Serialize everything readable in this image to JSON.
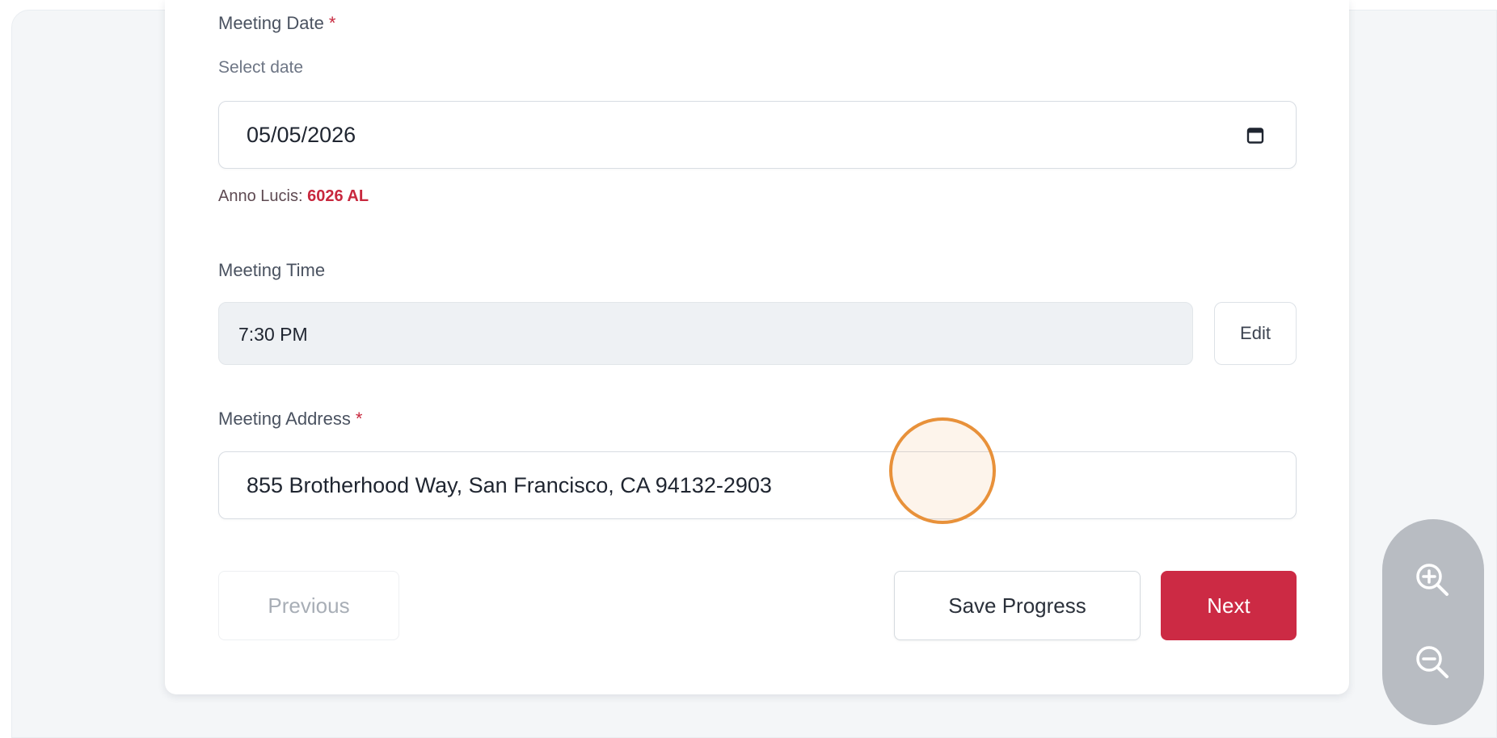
{
  "form": {
    "meeting_date": {
      "label": "Meeting Date",
      "required_mark": "*",
      "helper": "Select date",
      "value": "05/05/2026",
      "icon": "calendar-icon"
    },
    "anno_lucis": {
      "label": "Anno Lucis:",
      "value": "6026 AL"
    },
    "meeting_time": {
      "label": "Meeting Time",
      "value": "7:30 PM",
      "edit_label": "Edit"
    },
    "meeting_address": {
      "label": "Meeting Address",
      "required_mark": "*",
      "value": "855 Brotherhood Way, San Francisco, CA 94132-2903"
    }
  },
  "actions": {
    "previous_label": "Previous",
    "save_label": "Save Progress",
    "next_label": "Next"
  },
  "zoom": {
    "zoom_in_icon": "zoom-in-icon",
    "zoom_out_icon": "zoom-out-icon"
  },
  "colors": {
    "accent": "#cc2a44",
    "cursor_ring": "#e8913a",
    "zoom_panel": "#b8bcc2"
  }
}
